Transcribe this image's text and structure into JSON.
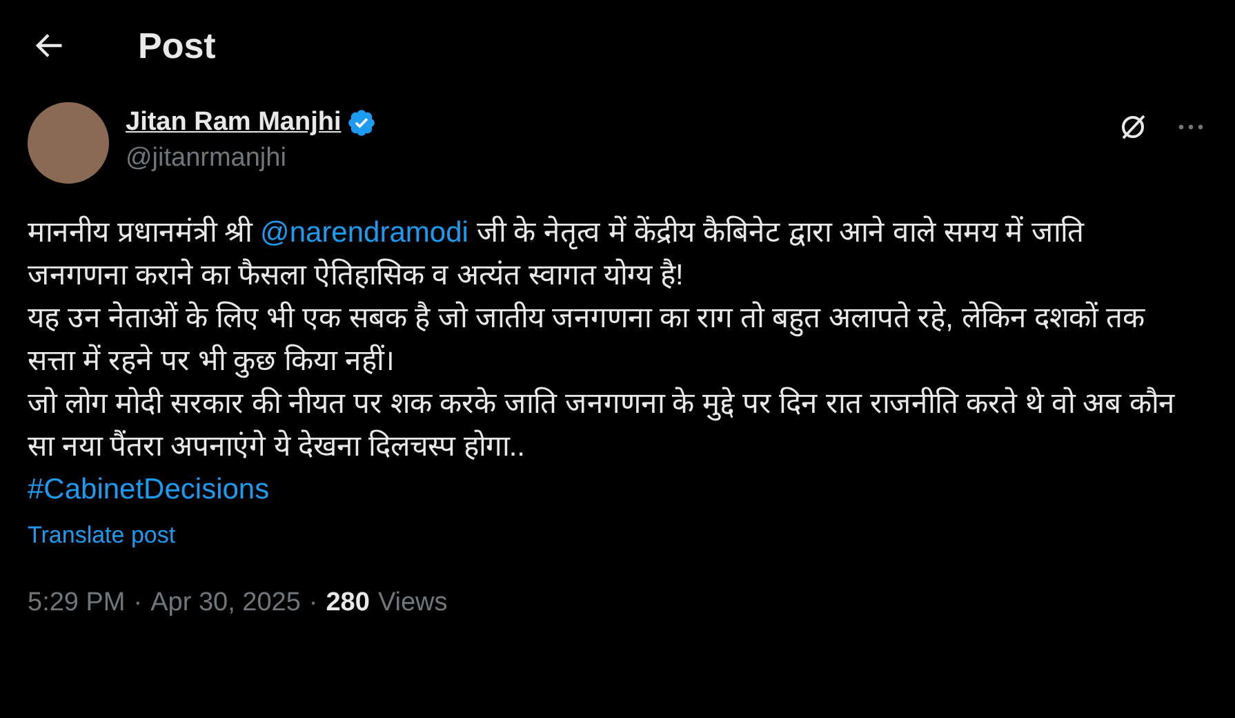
{
  "header": {
    "title": "Post"
  },
  "author": {
    "name": "Jitan Ram Manjhi",
    "verified": true,
    "handle": "@jitanrmanjhi"
  },
  "body": {
    "paragraphs": [
      [
        {
          "kind": "text",
          "text": "माननीय प्रधानमंत्री श्री "
        },
        {
          "kind": "mention",
          "text": "@narendramodi"
        },
        {
          "kind": "text",
          "text": " जी के नेतृत्व में केंद्रीय कैबिनेट द्वारा आने वाले समय में जाति जनगणना कराने का फैसला ऐतिहासिक व अत्यंत स्वागत योग्य है!"
        }
      ],
      [
        {
          "kind": "text",
          "text": "यह उन नेताओं के लिए भी एक सबक है जो जातीय जनगणना का राग तो बहुत अलापते रहे, लेकिन दशकों तक सत्ता में रहने पर भी कुछ किया नहीं।"
        }
      ],
      [
        {
          "kind": "text",
          "text": "जो लोग मोदी सरकार की नीयत पर शक करके जाति जनगणना के मुद्दे पर दिन रात राजनीति करते थे वो अब कौन सा नया पैंतरा अपनाएंगे ये देखना दिलचस्प होगा.."
        }
      ]
    ],
    "hashtag": "#CabinetDecisions"
  },
  "translate_link": "Translate post",
  "meta": [
    {
      "kind": "plain",
      "text": "5:29 PM"
    },
    {
      "kind": "dot",
      "text": "·"
    },
    {
      "kind": "plain",
      "text": "Apr 30, 2025"
    },
    {
      "kind": "dot",
      "text": "·"
    },
    {
      "kind": "count",
      "text": "280"
    },
    {
      "kind": "plain",
      "text": "Views"
    }
  ]
}
